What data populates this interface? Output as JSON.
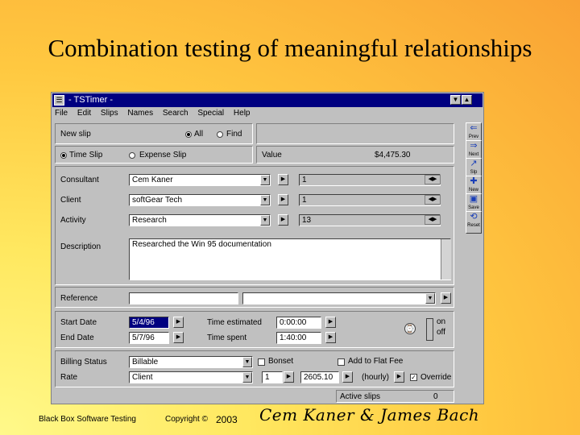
{
  "slide": {
    "title": "Combination testing of meaningful relationships",
    "footer_left": "Black Box Software Testing",
    "footer_copyright": "Copyright ©",
    "footer_year": "2003",
    "signature": "Cem Kaner & James Bach"
  },
  "window": {
    "title": "- TSTimer -",
    "minimize_glyph": "▼",
    "maximize_glyph": "▲",
    "menus": [
      "File",
      "Edit",
      "Slips",
      "Names",
      "Search",
      "Special",
      "Help"
    ]
  },
  "slip_bar": {
    "new_slip": "New slip",
    "radio_all": "All",
    "radio_find": "Find",
    "time_slip": "Time Slip",
    "expense_slip": "Expense Slip",
    "value_label": "Value",
    "value": "$4,475.30"
  },
  "form": {
    "consultant_label": "Consultant",
    "consultant_value": "Cem Kaner",
    "consultant_num": "1",
    "client_label": "Client",
    "client_value": "softGear Tech",
    "client_num": "1",
    "activity_label": "Activity",
    "activity_value": "Research",
    "activity_num": "13",
    "description_label": "Description",
    "description_value": "Researched the Win 95 documentation",
    "reference_label": "Reference",
    "start_date_label": "Start Date",
    "start_date": "5/4/96",
    "end_date_label": "End Date",
    "end_date": "5/7/96",
    "time_estimated_label": "Time estimated",
    "time_estimated": "0:00:00",
    "time_spent_label": "Time spent",
    "time_spent": "1:40:00",
    "timer_on": "on",
    "timer_off": "off",
    "billing_status_label": "Billing Status",
    "billing_status": "Billable",
    "rate_label": "Rate",
    "rate_value": "Client",
    "rate_num": "1",
    "rate_amount": "2605.10",
    "rate_unit": "(hourly)",
    "bonset_label": "Bonset",
    "add_flat_fee_label": "Add to Flat Fee",
    "override_label": "Override",
    "active_slips_label": "Active slips",
    "active_slips": "0"
  },
  "toolbar": [
    {
      "label": "Prev",
      "icon": "prev-arrow-icon",
      "glyph": "⇐"
    },
    {
      "label": "Next",
      "icon": "next-arrow-icon",
      "glyph": "⇒"
    },
    {
      "label": "Slp",
      "icon": "chart-icon",
      "glyph": "↗"
    },
    {
      "label": "New",
      "icon": "add-icon",
      "glyph": "✚"
    },
    {
      "label": "Save",
      "icon": "save-icon",
      "glyph": "▣"
    },
    {
      "label": "Reset",
      "icon": "reset-icon",
      "glyph": "⟲"
    }
  ]
}
